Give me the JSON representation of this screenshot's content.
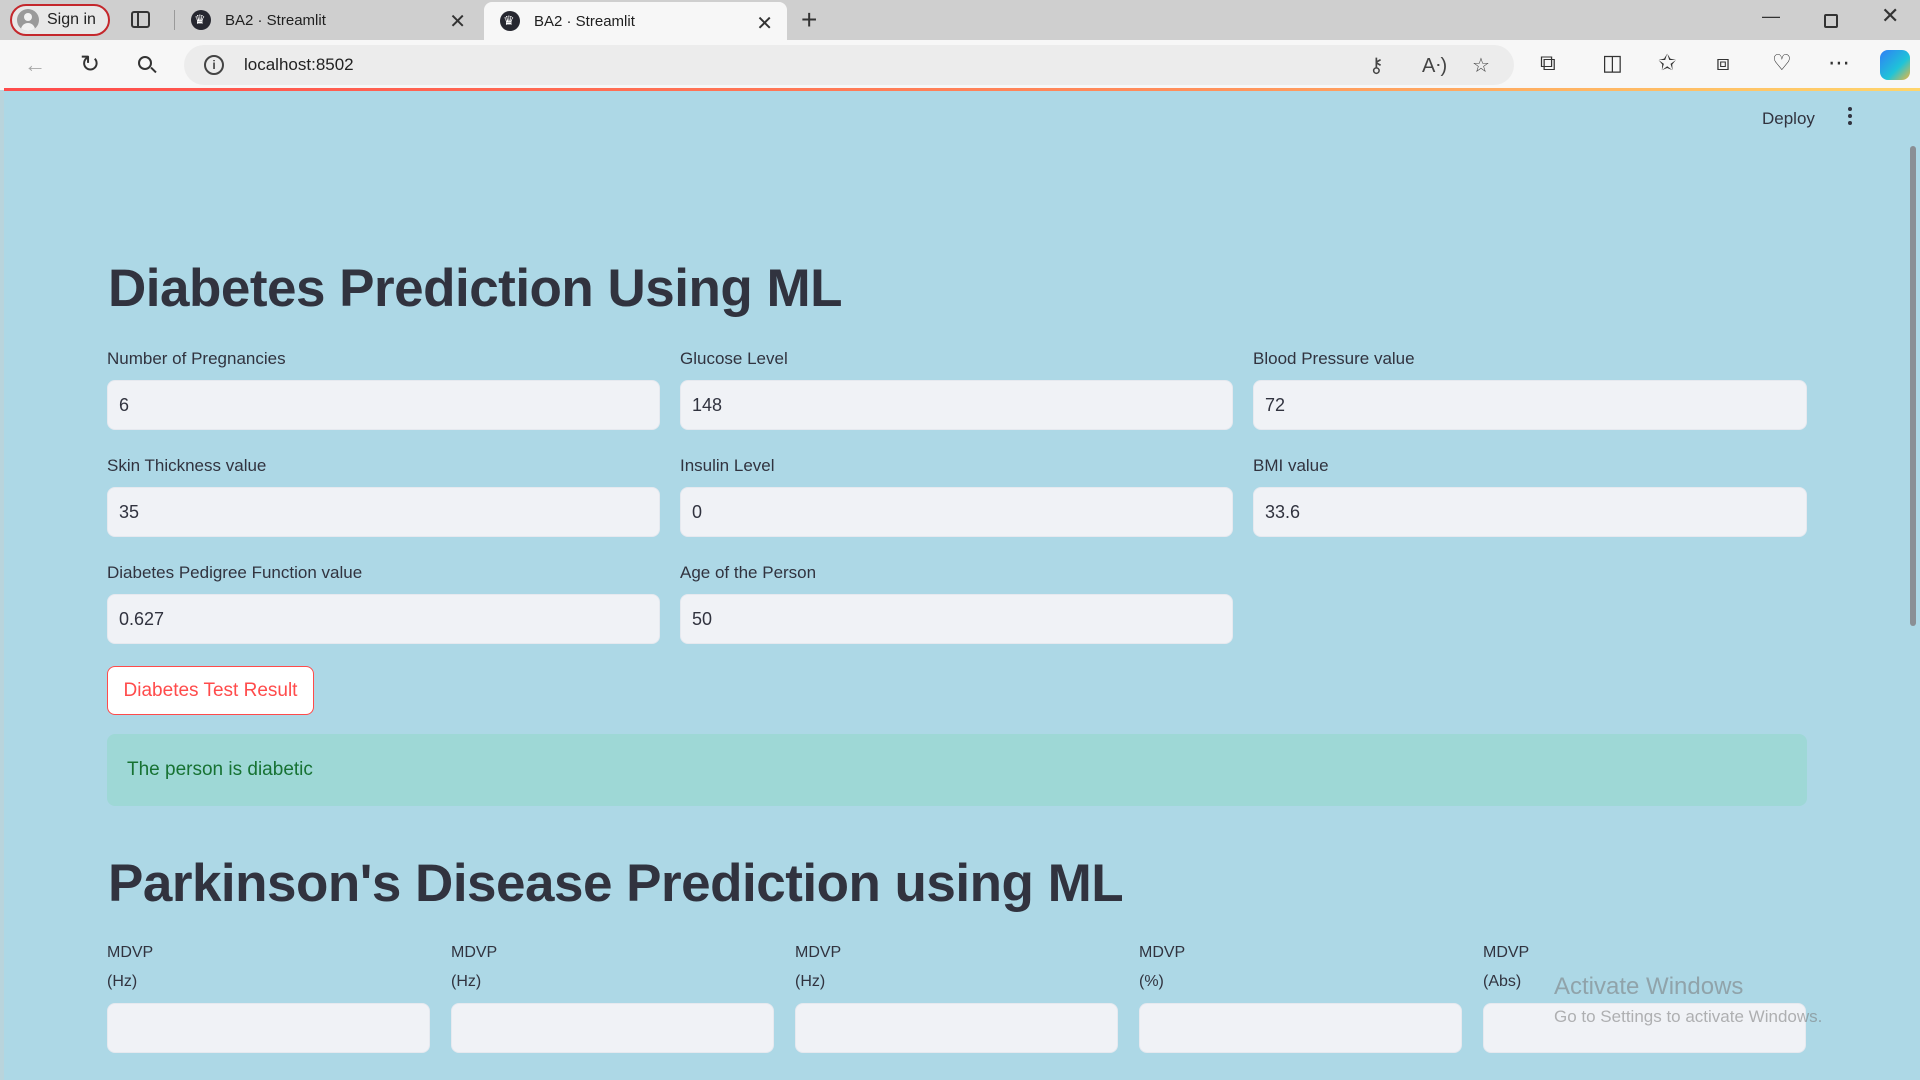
{
  "browser": {
    "signin_label": "Sign in",
    "tabs": [
      {
        "title": "BA2 · Streamlit",
        "active": false
      },
      {
        "title": "BA2 · Streamlit",
        "active": true
      }
    ],
    "url": "localhost:8502"
  },
  "app": {
    "deploy_label": "Deploy",
    "diabetes": {
      "title": "Diabetes Prediction Using ML",
      "fields": [
        {
          "label": "Number of Pregnancies",
          "value": "6"
        },
        {
          "label": "Glucose Level",
          "value": "148"
        },
        {
          "label": "Blood Pressure value",
          "value": "72"
        },
        {
          "label": "Skin Thickness value",
          "value": "35"
        },
        {
          "label": "Insulin Level",
          "value": "0"
        },
        {
          "label": "BMI value",
          "value": "33.6"
        },
        {
          "label": "Diabetes Pedigree Function value",
          "value": "0.627"
        },
        {
          "label": "Age of the Person",
          "value": "50"
        }
      ],
      "button_label": "Diabetes Test Result",
      "result": "The person is diabetic"
    },
    "parkinsons": {
      "title": "Parkinson's Disease Prediction using ML",
      "fields": [
        {
          "label_line1": "MDVP",
          "label_line2": "(Hz)",
          "value": ""
        },
        {
          "label_line1": "MDVP",
          "label_line2": "(Hz)",
          "value": ""
        },
        {
          "label_line1": "MDVP",
          "label_line2": "(Hz)",
          "value": ""
        },
        {
          "label_line1": "MDVP",
          "label_line2": "(%)",
          "value": ""
        },
        {
          "label_line1": "MDVP",
          "label_line2": "(Abs)",
          "value": ""
        }
      ]
    }
  },
  "watermark": {
    "line1": "Activate Windows",
    "line2": "Go to Settings to activate Windows."
  }
}
